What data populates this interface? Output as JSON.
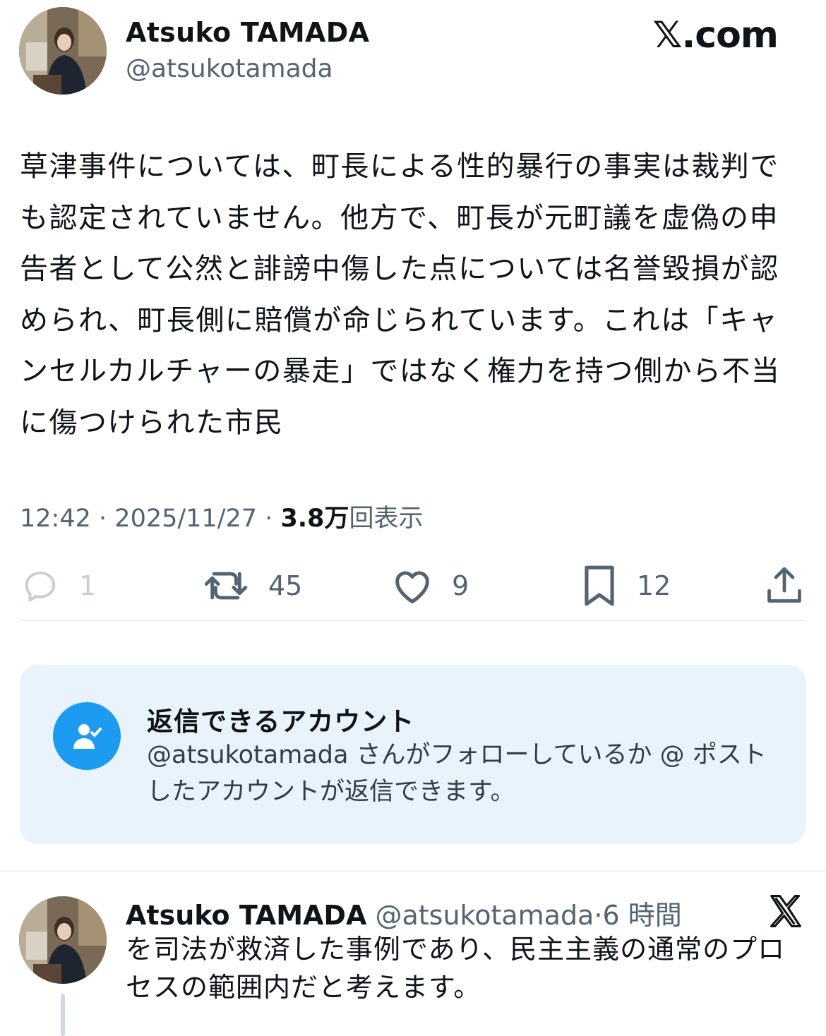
{
  "header": {
    "display_name": "Atsuko TAMADA",
    "handle": "@atsukotamada",
    "logo_text": "𝕏.com"
  },
  "post": {
    "text": "草津事件については、町長による性的暴行の事実は裁判でも認定されていません。他方で、町長が元町議を虚偽の申告者として公然と誹謗中傷した点については名誉毀損が認められ、町長側に賠償が命じられています。これは「キャンセルカルチャーの暴走」ではなく権力を持つ側から不当に傷つけられた市民",
    "time": "12:42",
    "separator": "·",
    "date": "2025/11/27",
    "views_count": "3.8万",
    "views_label": "回表示"
  },
  "actions": {
    "reply_count": "1",
    "repost_count": "45",
    "like_count": "9",
    "bookmark_count": "12",
    "icons": [
      "reply-icon",
      "repost-icon",
      "like-icon",
      "bookmark-icon",
      "share-icon"
    ]
  },
  "reply_restriction": {
    "title": "返信できるアカウント",
    "description": "@atsukotamada さんがフォローしているか @ ポストしたアカウントが返信できます。",
    "icon": "user-check-icon",
    "accent_color": "#1d9bf0",
    "background_color": "#e9f3fb"
  },
  "thread_reply": {
    "display_name": "Atsuko TAMADA",
    "handle": "@atsukotamada",
    "separator": "·",
    "time": "6 時間",
    "text": "を司法が救済した事例であり、民主主義の通常のプロセスの範囲内だと考えます。",
    "logo_icon": "x-logo-icon"
  }
}
